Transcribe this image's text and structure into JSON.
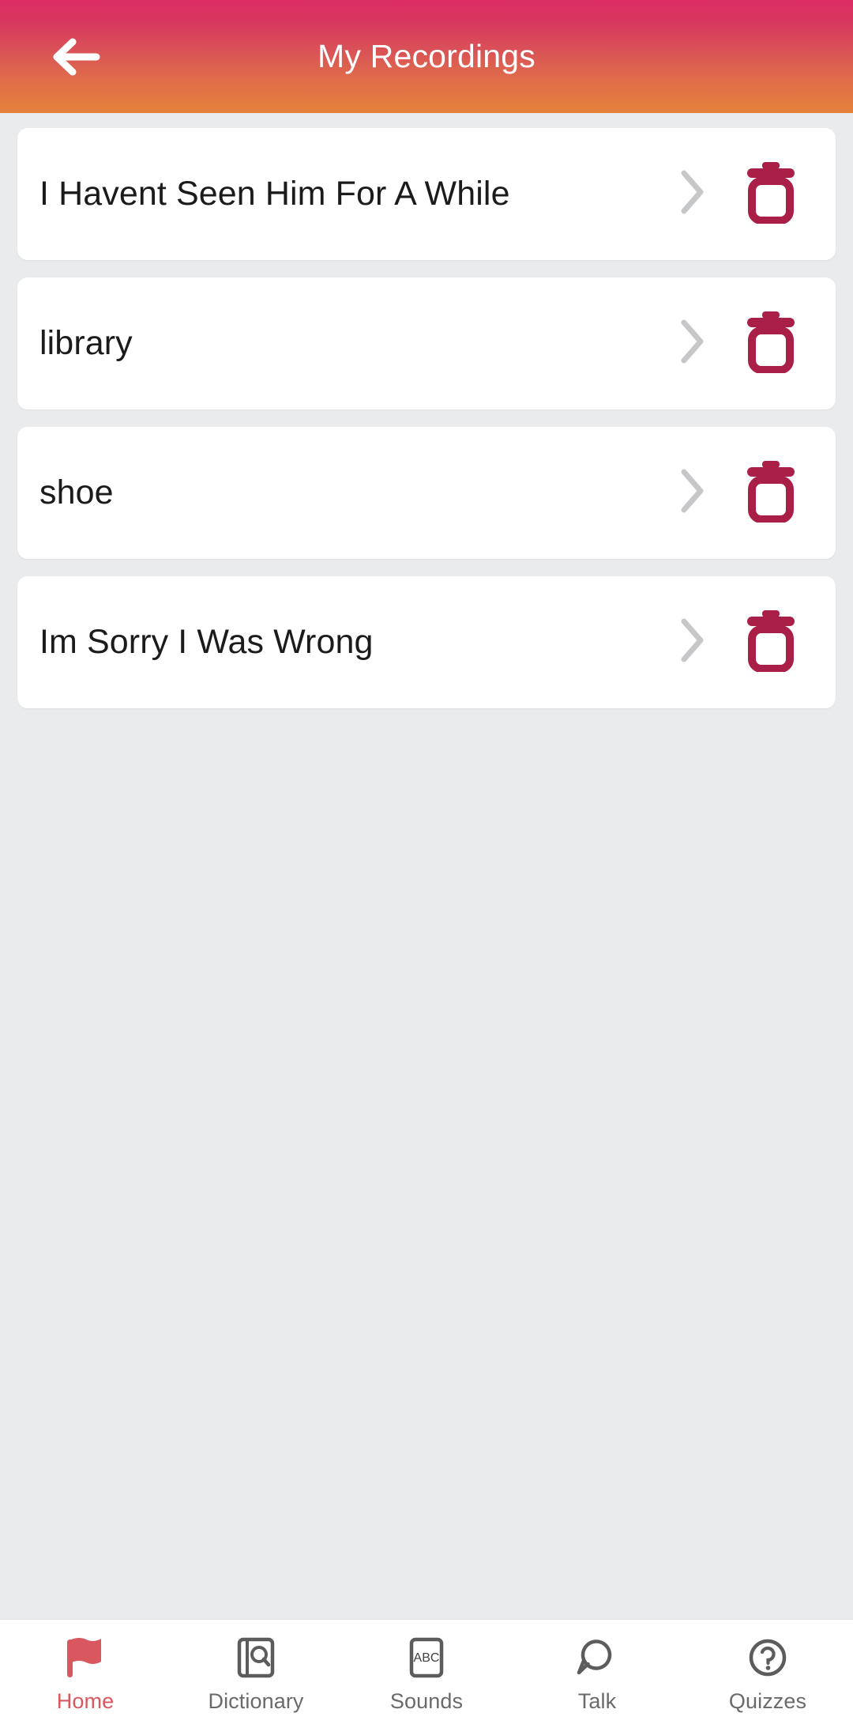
{
  "header": {
    "title": "My Recordings",
    "back_icon": "arrow-left-icon",
    "gradient_start": "#db2d62",
    "gradient_end": "#e4833c",
    "title_color": "#ffffff"
  },
  "colors": {
    "page_background": "#eaebed",
    "card_background": "#ffffff",
    "card_title": "#1b1b1b",
    "chevron": "#c6c7c9",
    "trash": "#a91f47",
    "nav_inactive": "#6a6a6a",
    "nav_active": "#d9585f",
    "nav_background": "#ffffff"
  },
  "recordings": {
    "count": 4,
    "items": [
      {
        "title": "I Havent Seen Him For A While",
        "chevron_icon": "chevron-right-icon",
        "delete_icon": "trash-icon"
      },
      {
        "title": "library",
        "chevron_icon": "chevron-right-icon",
        "delete_icon": "trash-icon"
      },
      {
        "title": "shoe",
        "chevron_icon": "chevron-right-icon",
        "delete_icon": "trash-icon"
      },
      {
        "title": "Im Sorry I Was Wrong",
        "chevron_icon": "chevron-right-icon",
        "delete_icon": "trash-icon"
      }
    ]
  },
  "bottom_nav": {
    "active_index": 0,
    "items": [
      {
        "label": "Home",
        "icon": "flag-icon"
      },
      {
        "label": "Dictionary",
        "icon": "book-search-icon"
      },
      {
        "label": "Sounds",
        "icon": "abc-card-icon"
      },
      {
        "label": "Talk",
        "icon": "speech-bubble-icon"
      },
      {
        "label": "Quizzes",
        "icon": "question-circle-icon"
      }
    ]
  }
}
